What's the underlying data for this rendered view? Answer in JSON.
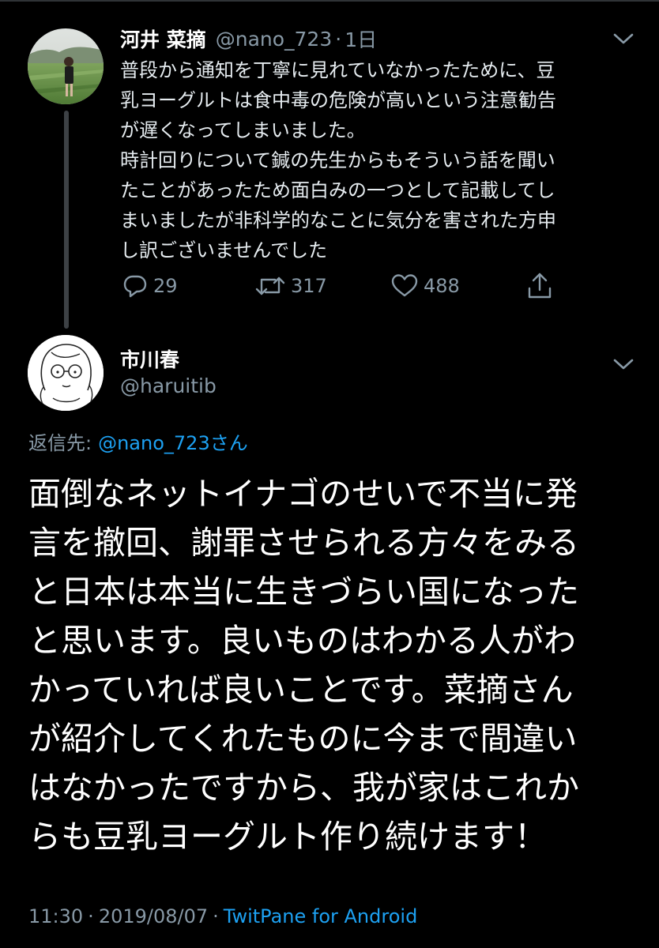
{
  "colors": {
    "background": "#000000",
    "text_primary": "#ffffff",
    "text_secondary": "#8899a6",
    "link": "#1da1f2",
    "thread_line": "#3d4145"
  },
  "tweet1": {
    "author_name": "河井 菜摘",
    "author_handle": "@nano_723",
    "separator": "·",
    "time_ago": "1日",
    "avatar_icon": "profile-photo",
    "menu_icon": "chevron-down-icon",
    "body_lines": [
      "普段から通知を丁寧に見れていなかったために、豆",
      "乳ヨーグルトは食中毒の危険が高いという注意勧告",
      "が遅くなってしまいました。",
      "時計回りについて鍼の先生からもそういう話を聞い",
      "たことがあったため面白みの一つとして記載してし",
      "まいましたが非科学的なことに気分を害された方申",
      "し訳ございませんでした"
    ],
    "actions": {
      "reply_count": "29",
      "retweet_count": "317",
      "like_count": "488"
    }
  },
  "tweet2": {
    "author_name": "市川春",
    "author_handle": "@haruitib",
    "avatar_icon": "illustrated-avatar",
    "menu_icon": "chevron-down-icon",
    "reply_to_label": "返信先:",
    "reply_to_user": "@nano_723さん",
    "body_lines": [
      "面倒なネットイナゴのせいで不当に発",
      "言を撤回、謝罪させられる方々をみる",
      "と日本は本当に生きづらい国になった",
      "と思います。良いものはわかる人がわ",
      "かっていれば良いことです。菜摘さん",
      "が紹介してくれたものに今まで間違い",
      "はなかったですから、我が家はこれか",
      "らも豆乳ヨーグルト作り続けます！"
    ],
    "time": "11:30",
    "separator": "·",
    "date": "2019/08/07",
    "source": "TwitPane for Android"
  }
}
